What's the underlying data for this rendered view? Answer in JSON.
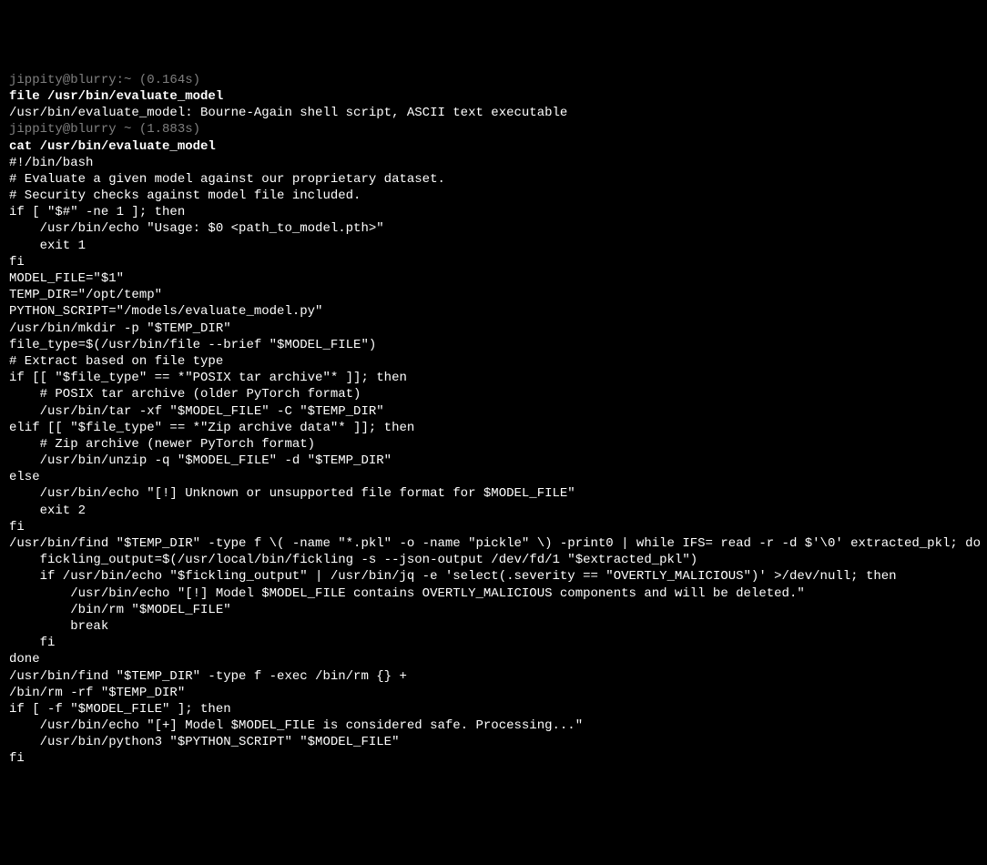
{
  "blocks": [
    {
      "prompt": "jippity@blurry:~ (0.164s)",
      "command": "file /usr/bin/evaluate_model",
      "output_lines": [
        "/usr/bin/evaluate_model: Bourne-Again shell script, ASCII text executable"
      ]
    },
    {
      "prompt": "jippity@blurry ~ (1.883s)",
      "command": "cat /usr/bin/evaluate_model",
      "output_lines": [
        "#!/bin/bash",
        "# Evaluate a given model against our proprietary dataset.",
        "# Security checks against model file included.",
        "",
        "if [ \"$#\" -ne 1 ]; then",
        "    /usr/bin/echo \"Usage: $0 <path_to_model.pth>\"",
        "    exit 1",
        "fi",
        "",
        "MODEL_FILE=\"$1\"",
        "TEMP_DIR=\"/opt/temp\"",
        "PYTHON_SCRIPT=\"/models/evaluate_model.py\"",
        "",
        "/usr/bin/mkdir -p \"$TEMP_DIR\"",
        "",
        "file_type=$(/usr/bin/file --brief \"$MODEL_FILE\")",
        "",
        "# Extract based on file type",
        "if [[ \"$file_type\" == *\"POSIX tar archive\"* ]]; then",
        "    # POSIX tar archive (older PyTorch format)",
        "    /usr/bin/tar -xf \"$MODEL_FILE\" -C \"$TEMP_DIR\"",
        "elif [[ \"$file_type\" == *\"Zip archive data\"* ]]; then",
        "    # Zip archive (newer PyTorch format)",
        "    /usr/bin/unzip -q \"$MODEL_FILE\" -d \"$TEMP_DIR\"",
        "else",
        "    /usr/bin/echo \"[!] Unknown or unsupported file format for $MODEL_FILE\"",
        "    exit 2",
        "fi",
        "",
        "/usr/bin/find \"$TEMP_DIR\" -type f \\( -name \"*.pkl\" -o -name \"pickle\" \\) -print0 | while IFS= read -r -d $'\\0' extracted_pkl; do",
        "    fickling_output=$(/usr/local/bin/fickling -s --json-output /dev/fd/1 \"$extracted_pkl\")",
        "",
        "    if /usr/bin/echo \"$fickling_output\" | /usr/bin/jq -e 'select(.severity == \"OVERTLY_MALICIOUS\")' >/dev/null; then",
        "        /usr/bin/echo \"[!] Model $MODEL_FILE contains OVERTLY_MALICIOUS components and will be deleted.\"",
        "        /bin/rm \"$MODEL_FILE\"",
        "        break",
        "    fi",
        "done",
        "",
        "/usr/bin/find \"$TEMP_DIR\" -type f -exec /bin/rm {} +",
        "/bin/rm -rf \"$TEMP_DIR\"",
        "",
        "if [ -f \"$MODEL_FILE\" ]; then",
        "    /usr/bin/echo \"[+] Model $MODEL_FILE is considered safe. Processing...\"",
        "    /usr/bin/python3 \"$PYTHON_SCRIPT\" \"$MODEL_FILE\"",
        "fi"
      ]
    }
  ]
}
